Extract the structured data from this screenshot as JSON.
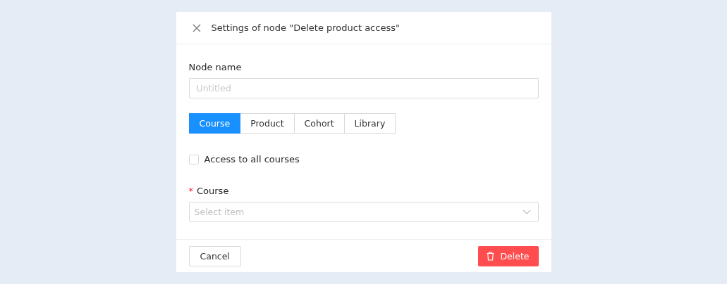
{
  "dialog": {
    "title": "Settings of node \"Delete product access\""
  },
  "node_name": {
    "label": "Node name",
    "placeholder": "Untitled"
  },
  "tabs": [
    {
      "label": "Course",
      "selected": true
    },
    {
      "label": "Product",
      "selected": false
    },
    {
      "label": "Cohort",
      "selected": false
    },
    {
      "label": "Library",
      "selected": false
    }
  ],
  "all_access": {
    "label": "Access to all courses",
    "checked": false
  },
  "course": {
    "label": "Course",
    "required_mark": "*",
    "placeholder": "Select item"
  },
  "buttons": {
    "cancel": "Cancel",
    "delete": "Delete"
  }
}
